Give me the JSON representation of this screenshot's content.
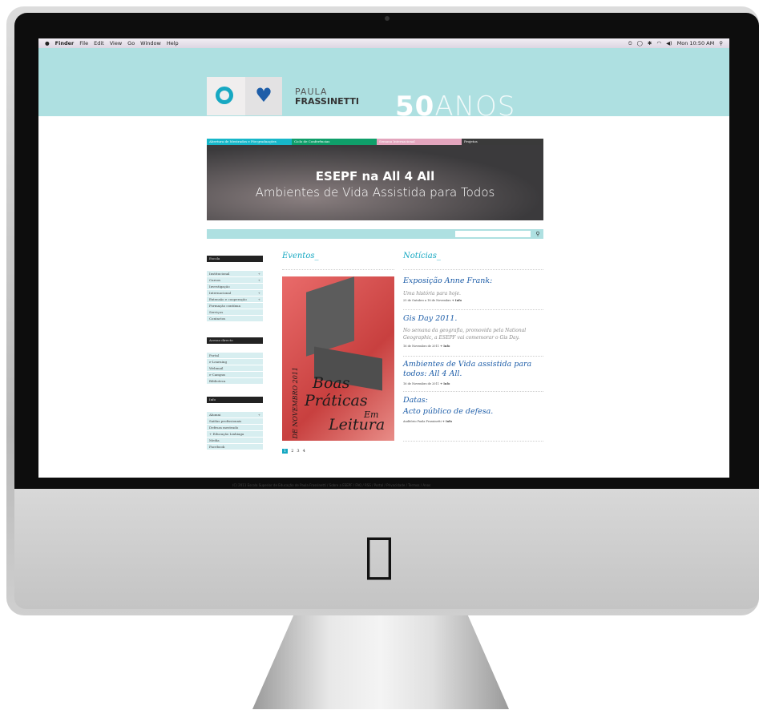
{
  "menubar": {
    "apple": "",
    "app": "Finder",
    "items": [
      "File",
      "Edit",
      "View",
      "Go",
      "Window",
      "Help"
    ],
    "status": [
      "⏲",
      "◯",
      "✱",
      "◠",
      "◀)",
      "Mon 10:50 AM",
      "⚲"
    ]
  },
  "brand": {
    "line1": "PAULA",
    "line2": "FRASSINETTI",
    "fifty": "50",
    "anos": "ANOS"
  },
  "tabs": [
    {
      "label": "Abertura de Mestrados e Pós-graduações",
      "color": "#17b7c9"
    },
    {
      "label": "Ciclo de Conferências",
      "color": "#0f9f6a"
    },
    {
      "label": "Semana Internacional",
      "color": "#e3a5bd"
    },
    {
      "label": "Projetos",
      "color": "#3a3a3a"
    }
  ],
  "banner": {
    "title": "ESEPF na All 4 All",
    "subtitle": "Ambientes de Vida Assistida para Todos"
  },
  "search": {
    "placeholder": "",
    "icon": "search-icon"
  },
  "sidebar": {
    "escola_title": "Escola",
    "escola_items": [
      {
        "label": "Institucional",
        "plus": "+"
      },
      {
        "label": "Cursos",
        "plus": "+"
      },
      {
        "label": "Investigação",
        "plus": ""
      },
      {
        "label": "Internacional",
        "plus": "+"
      },
      {
        "label": "Extensão e cooperação",
        "plus": "+"
      },
      {
        "label": "Formação contínua",
        "plus": ""
      },
      {
        "label": "Serviços",
        "plus": ""
      },
      {
        "label": "Contactos",
        "plus": ""
      }
    ],
    "acesso_title": "Acesso directo",
    "acesso_items": [
      {
        "label": "Portal"
      },
      {
        "label": "e-Learning"
      },
      {
        "label": "Webmail"
      },
      {
        "label": "e-Campus"
      },
      {
        "label": "Biblioteca"
      }
    ],
    "info_title": "Info",
    "info_items": [
      {
        "label": "Alumni",
        "plus": "+"
      },
      {
        "label": "Saídas profissionais",
        "plus": ""
      },
      {
        "label": "Defesas mestrado",
        "plus": ""
      },
      {
        "label": "+ Educação Linhiaga",
        "plus": ""
      },
      {
        "label": "Media",
        "plus": ""
      },
      {
        "label": "Facebook",
        "plus": ""
      }
    ]
  },
  "eventos": {
    "title": "Eventos_",
    "poster_lines": [
      "Boas",
      "Práticas",
      "Em",
      "Leitura"
    ],
    "poster_date": "5 DE NOVEMBRO 2011"
  },
  "noticias": {
    "title": "Notícias_",
    "items": [
      {
        "title": "Exposição Anne Frank:",
        "body": "Uma história para hoje.",
        "meta": "25 de Outubro a 18 de Novembro",
        "info": "+ Info"
      },
      {
        "title": "Gis Day 2011.",
        "body": "No semana da geografia, promovida pela National Geographic, a ESEPF vai comemorar o Gis Day.",
        "meta": "16 de Novembro de 2011",
        "info": "+ Info"
      },
      {
        "title": "Ambientes de Vida assistida para todos: All 4 All.",
        "body": "",
        "meta": "16 de Novembro de 2011",
        "info": "+ Info"
      },
      {
        "title": "Datas:",
        "title2": "Acto público de defesa.",
        "body": "",
        "meta": "Auditório Paula Frassinetti",
        "info": "+ Info"
      }
    ]
  },
  "pager": [
    "1",
    "2",
    "3",
    "4"
  ],
  "footer": "(C) 2011 Escola Superior de Educação de Paula Frassinetti / Sobre a ESEPF / FAQ / RSS / Portal / Privacidade / Termos / Anos",
  "colors": {
    "header": "#aee0e1",
    "accent": "#16a8c2",
    "title_blue": "#1d5da8"
  }
}
